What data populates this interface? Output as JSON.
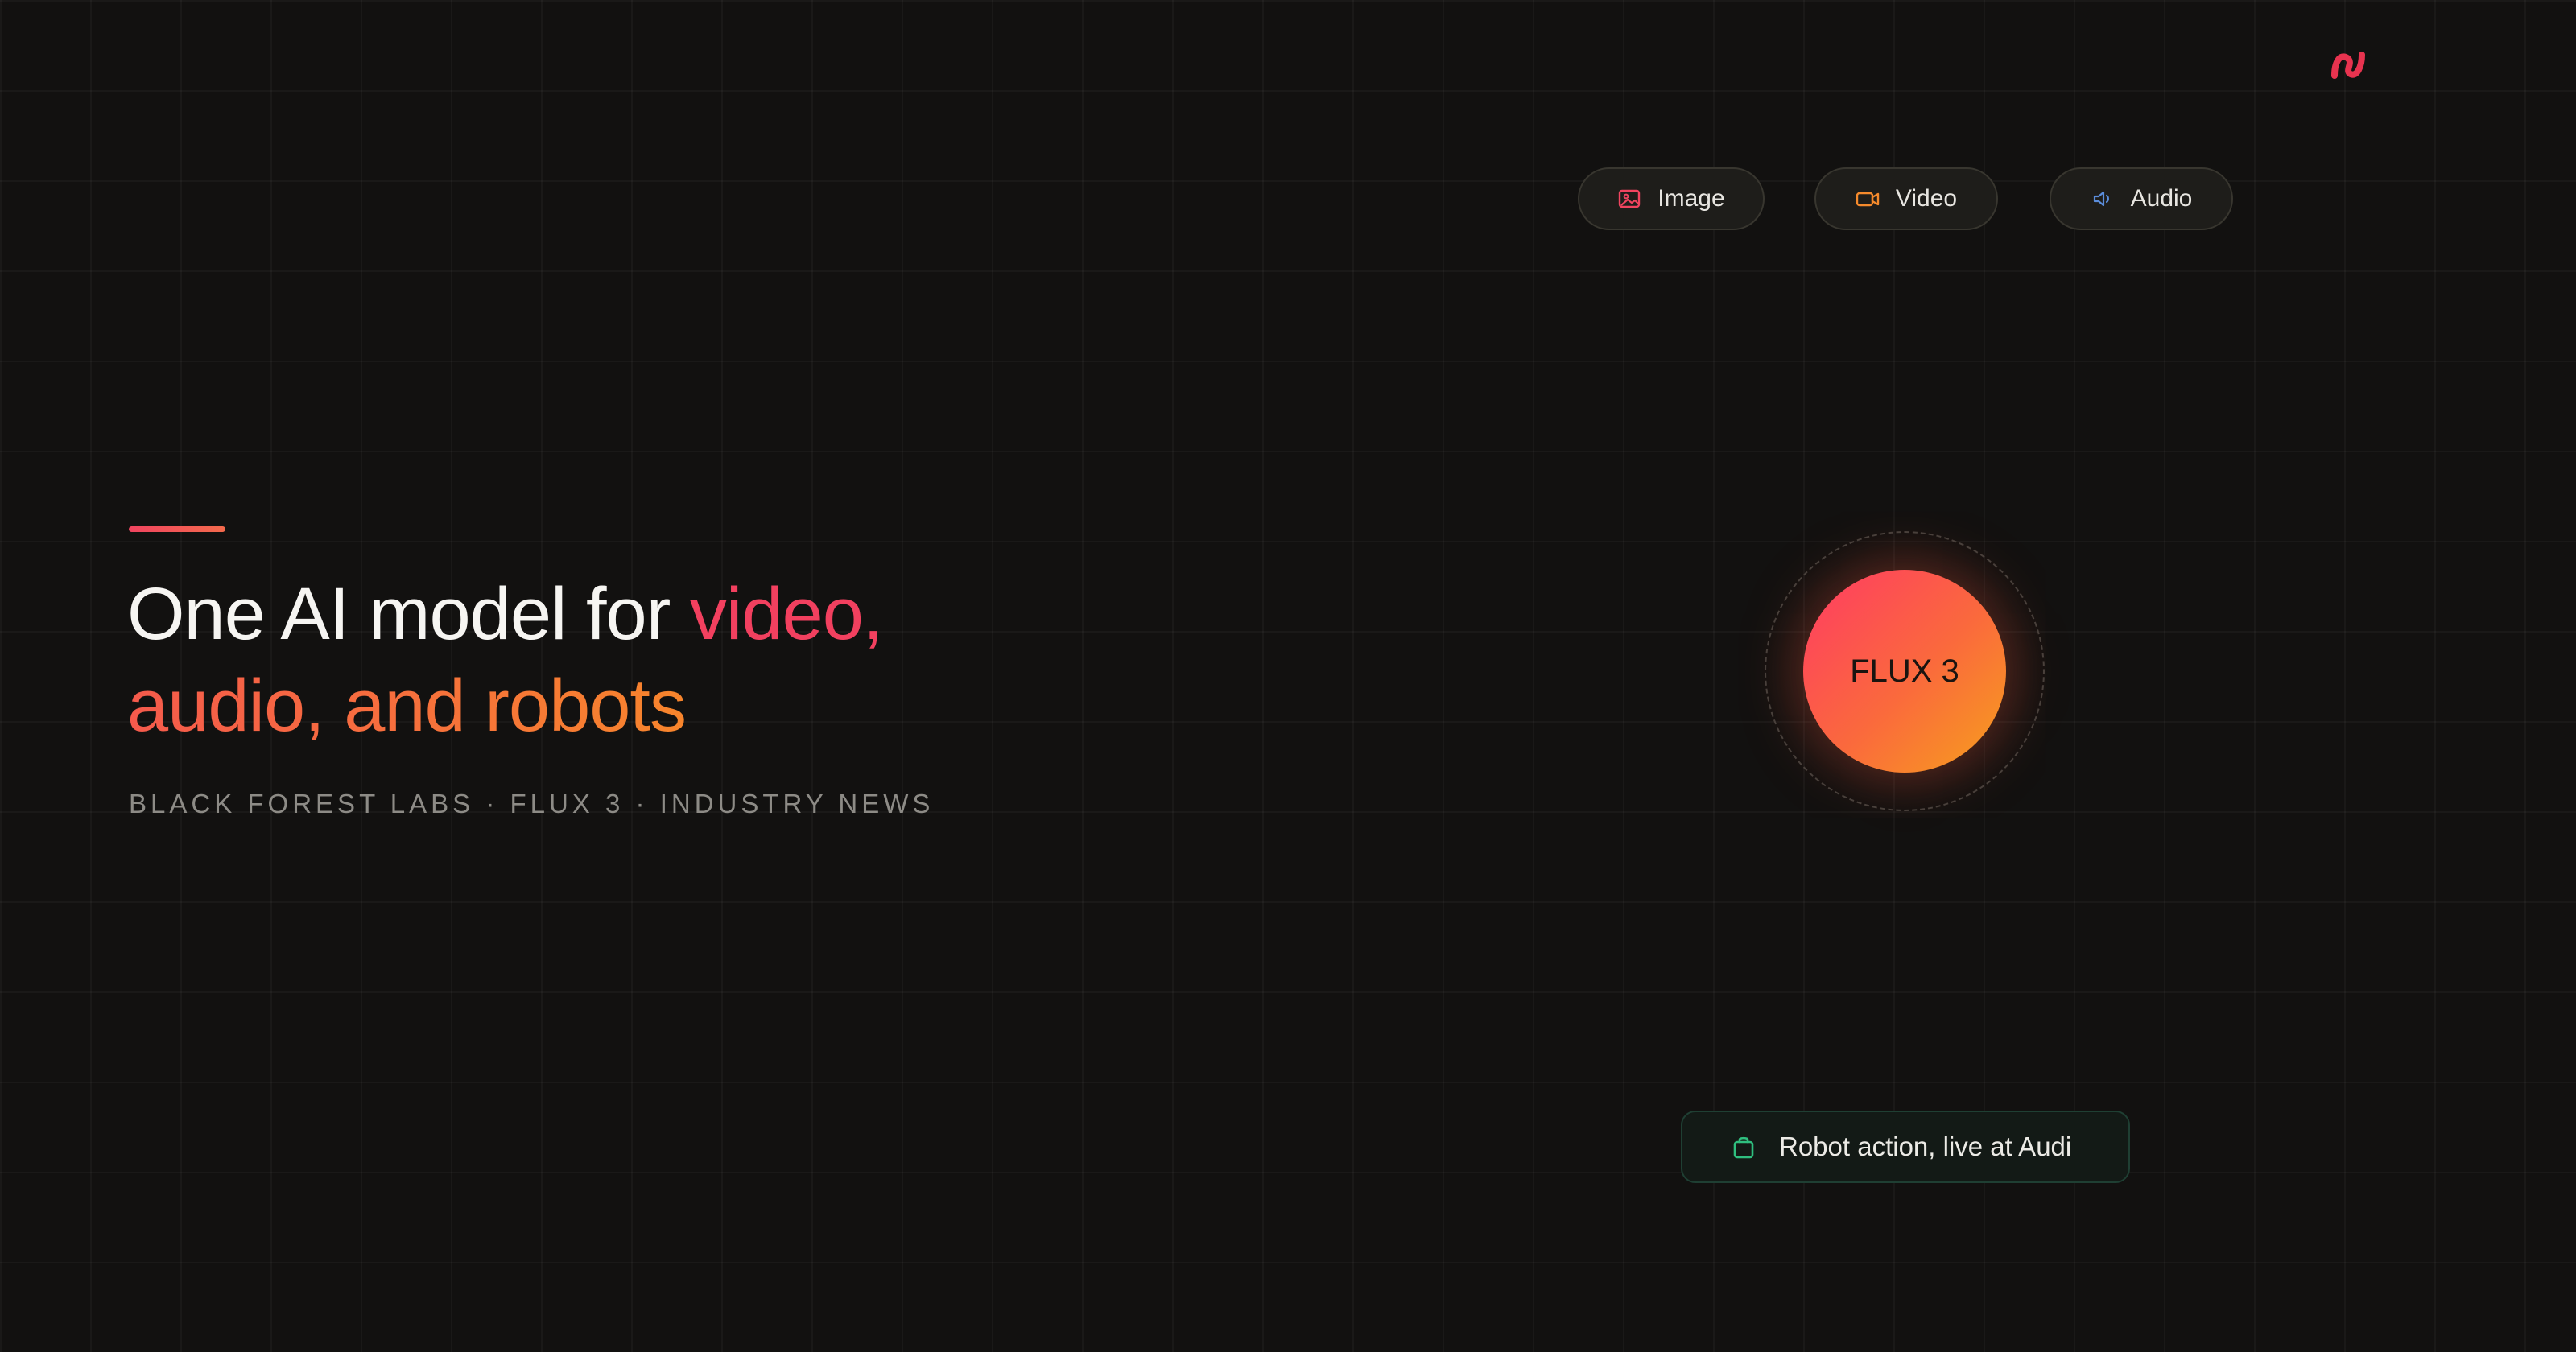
{
  "brand": {
    "logo_icon": "brand-logo-icon",
    "accent_color": "#e8334f"
  },
  "pills": [
    {
      "label": "Image",
      "icon": "image-icon",
      "color": "#f0445f"
    },
    {
      "label": "Video",
      "icon": "video-camera-icon",
      "color": "#f58a2c"
    },
    {
      "label": "Audio",
      "icon": "speaker-icon",
      "color": "#5b8ddb"
    }
  ],
  "hero": {
    "headline_part1": "One AI model for ",
    "headline_part2": "video,",
    "headline_part3": "audio, and robots",
    "subline": "BLACK FOREST LABS · FLUX 3 · INDUSTRY NEWS"
  },
  "orb": {
    "label": "FLUX 3"
  },
  "badge": {
    "label": "Robot action, live at Audi",
    "icon": "bag-icon",
    "color": "#2fbf7f"
  }
}
